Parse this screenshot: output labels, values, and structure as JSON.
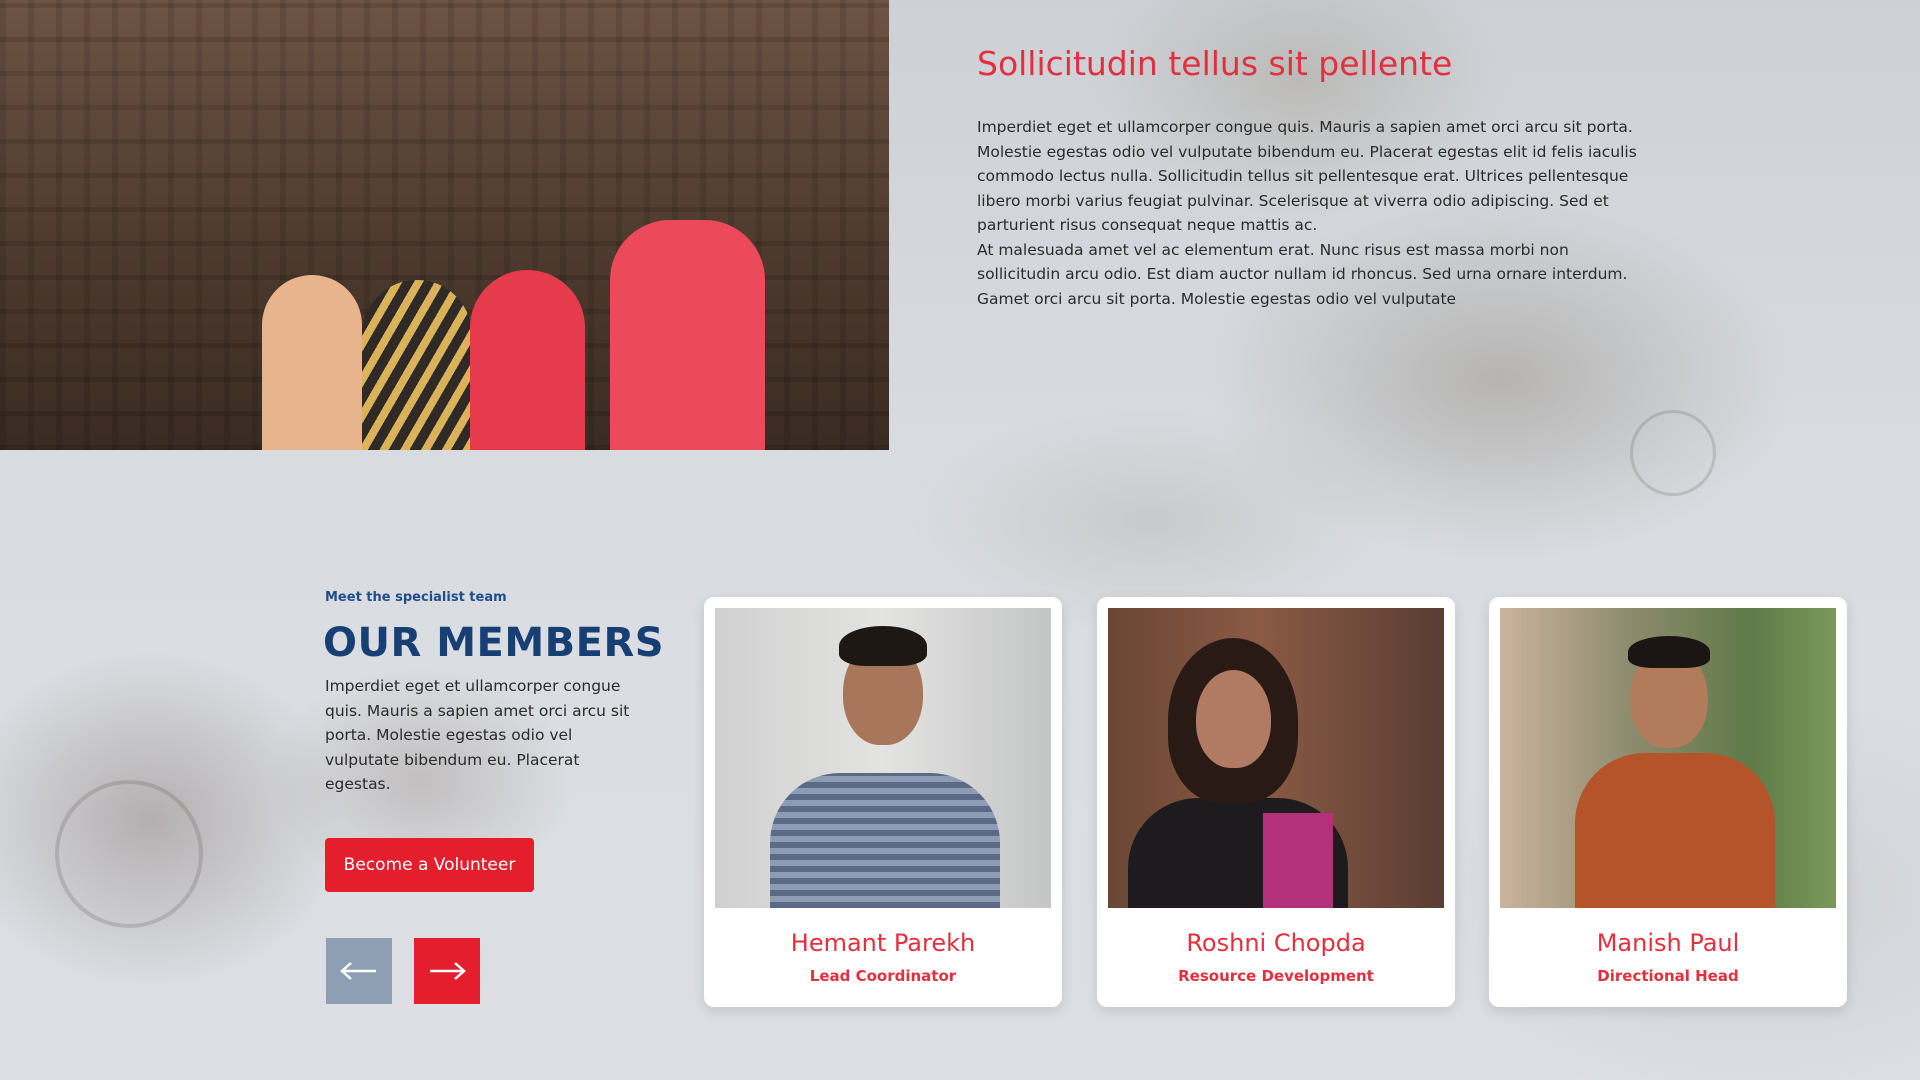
{
  "intro": {
    "title": "Sollicitudin tellus sit pellente",
    "paragraph_1": "Imperdiet eget et ullamcorper congue quis. Mauris a sapien amet orci arcu sit porta. Molestie egestas odio vel vulputate bibendum eu. Placerat egestas elit id felis iaculis commodo lectus nulla. Sollicitudin tellus sit pellentesque erat. Ultrices pellentesque libero morbi varius feugiat pulvinar. Scelerisque at viverra odio adipiscing. Sed et parturient risus consequat neque mattis ac.",
    "paragraph_2": "At malesuada amet vel ac elementum erat. Nunc risus est massa morbi non sollicitudin arcu odio. Est diam auctor nullam id rhoncus. Sed urna ornare interdum.",
    "paragraph_3": "Gamet orci arcu sit porta. Molestie egestas odio vel vulputate"
  },
  "members": {
    "eyebrow": "Meet the specialist team",
    "title": "OUR MEMBERS",
    "description": "Imperdiet eget et ullamcorper congue quis. Mauris a sapien amet orci arcu sit porta. Molestie egestas odio vel vulputate bibendum eu. Placerat egestas.",
    "volunteer_button": "Become a Volunteer",
    "prev_icon": "arrow-left-icon",
    "next_icon": "arrow-right-icon",
    "cards": [
      {
        "name": "Hemant Parekh",
        "role": "Lead Coordinator"
      },
      {
        "name": "Roshni Chopda",
        "role": "Resource Development"
      },
      {
        "name": "Manish Paul",
        "role": "Directional Head"
      }
    ]
  },
  "colors": {
    "accent_red": "#e51e2d",
    "heading_blue": "#173f73",
    "nav_prev_gray": "#8e9fb4"
  }
}
